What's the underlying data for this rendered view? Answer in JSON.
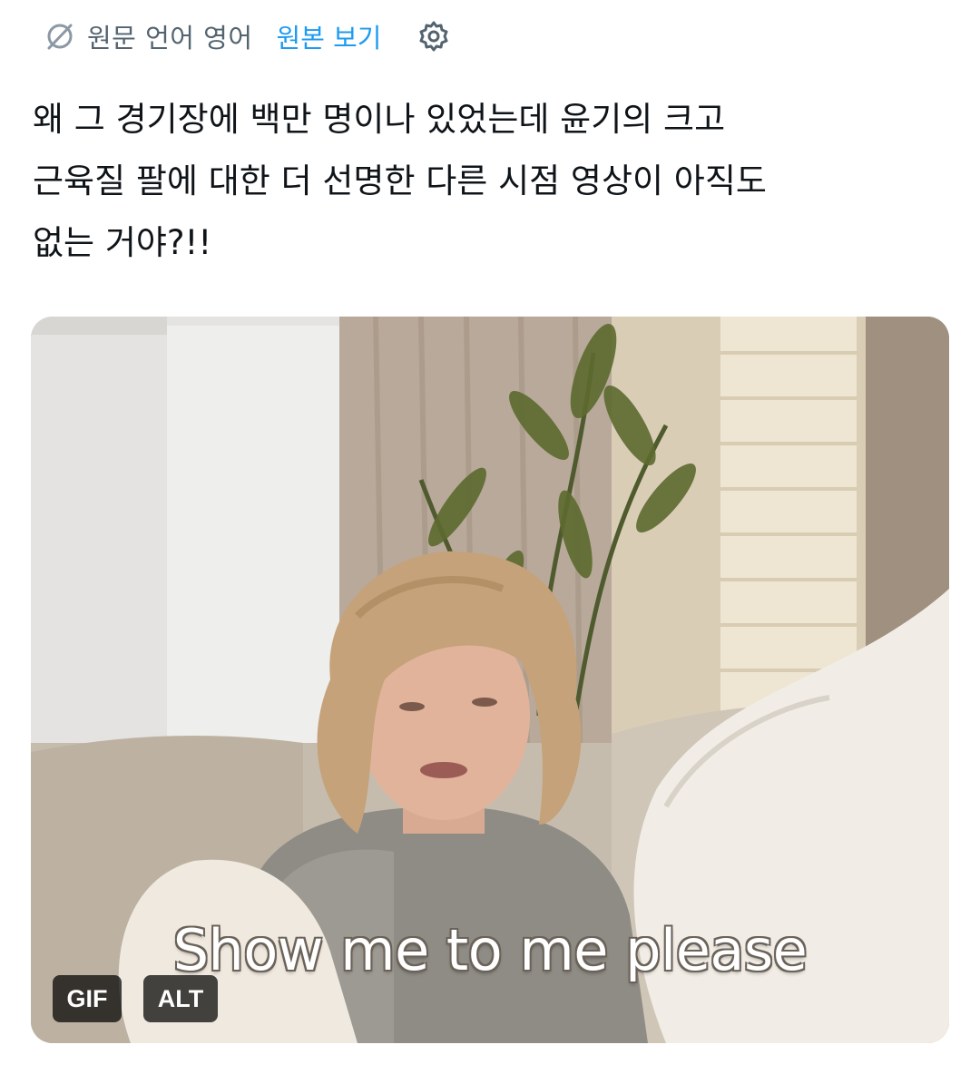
{
  "translation_bar": {
    "icon": "translate-icon",
    "label": "원문 언어 영어",
    "show_original": "원본 보기",
    "settings_icon": "gear-icon"
  },
  "tweet": {
    "text": "왜 그 경기장에 백만 명이나 있었는데 윤기의 크고\n근육질 팔에 대한 더 선명한 다른 시점 영상이 아직도\n없는 거야?!!"
  },
  "media": {
    "type": "gif",
    "caption": "Show me to me please",
    "badge_gif": "GIF",
    "badge_alt": "ALT"
  },
  "colors": {
    "link": "#1d9bf0",
    "muted": "#536471",
    "text": "#0f1419"
  }
}
